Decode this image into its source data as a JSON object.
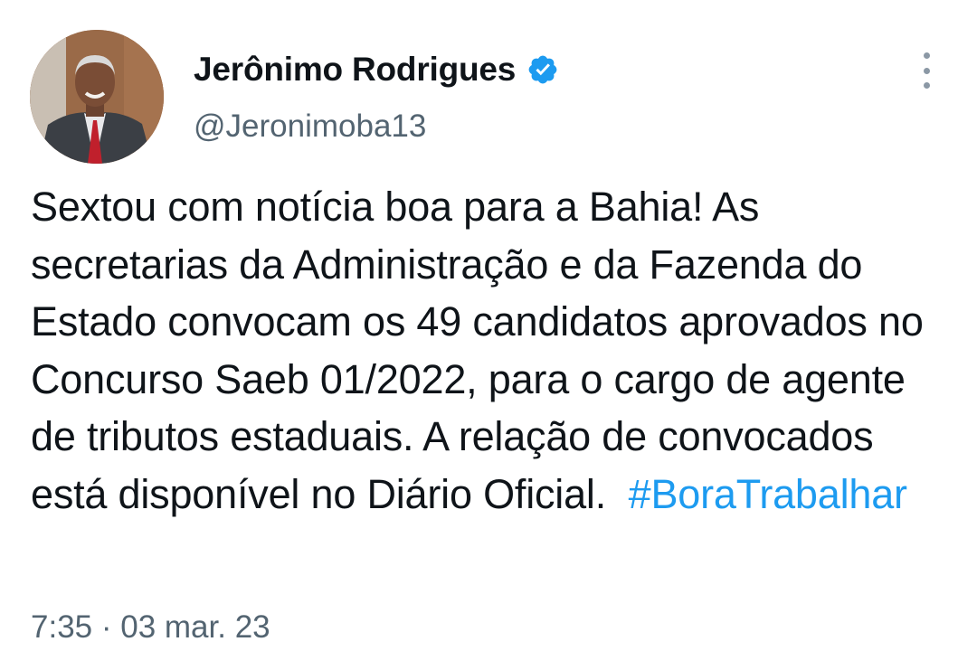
{
  "author": {
    "display_name": "Jerônimo Rodrigues",
    "handle": "@Jeronimoba13",
    "verified_icon": "verified-badge-icon",
    "avatar_icon": "profile-photo"
  },
  "tweet": {
    "text": "Sextou com notícia boa para a Bahia! As secretarias da Administração e da Fazenda do Estado convocam os 49 candidatos aprovados no Concurso Saeb 01/2022, para o cargo de agente de tributos estaduais. A relação de convocados está disponível no Diário Oficial.",
    "hashtag": "#BoraTrabalhar",
    "time": "7:35",
    "separator": "·",
    "date": "03 mar. 23"
  },
  "colors": {
    "accent": "#1d9bf0",
    "text_primary": "#0f1419",
    "text_secondary": "#536471"
  },
  "menu_icon": "more-options-icon"
}
